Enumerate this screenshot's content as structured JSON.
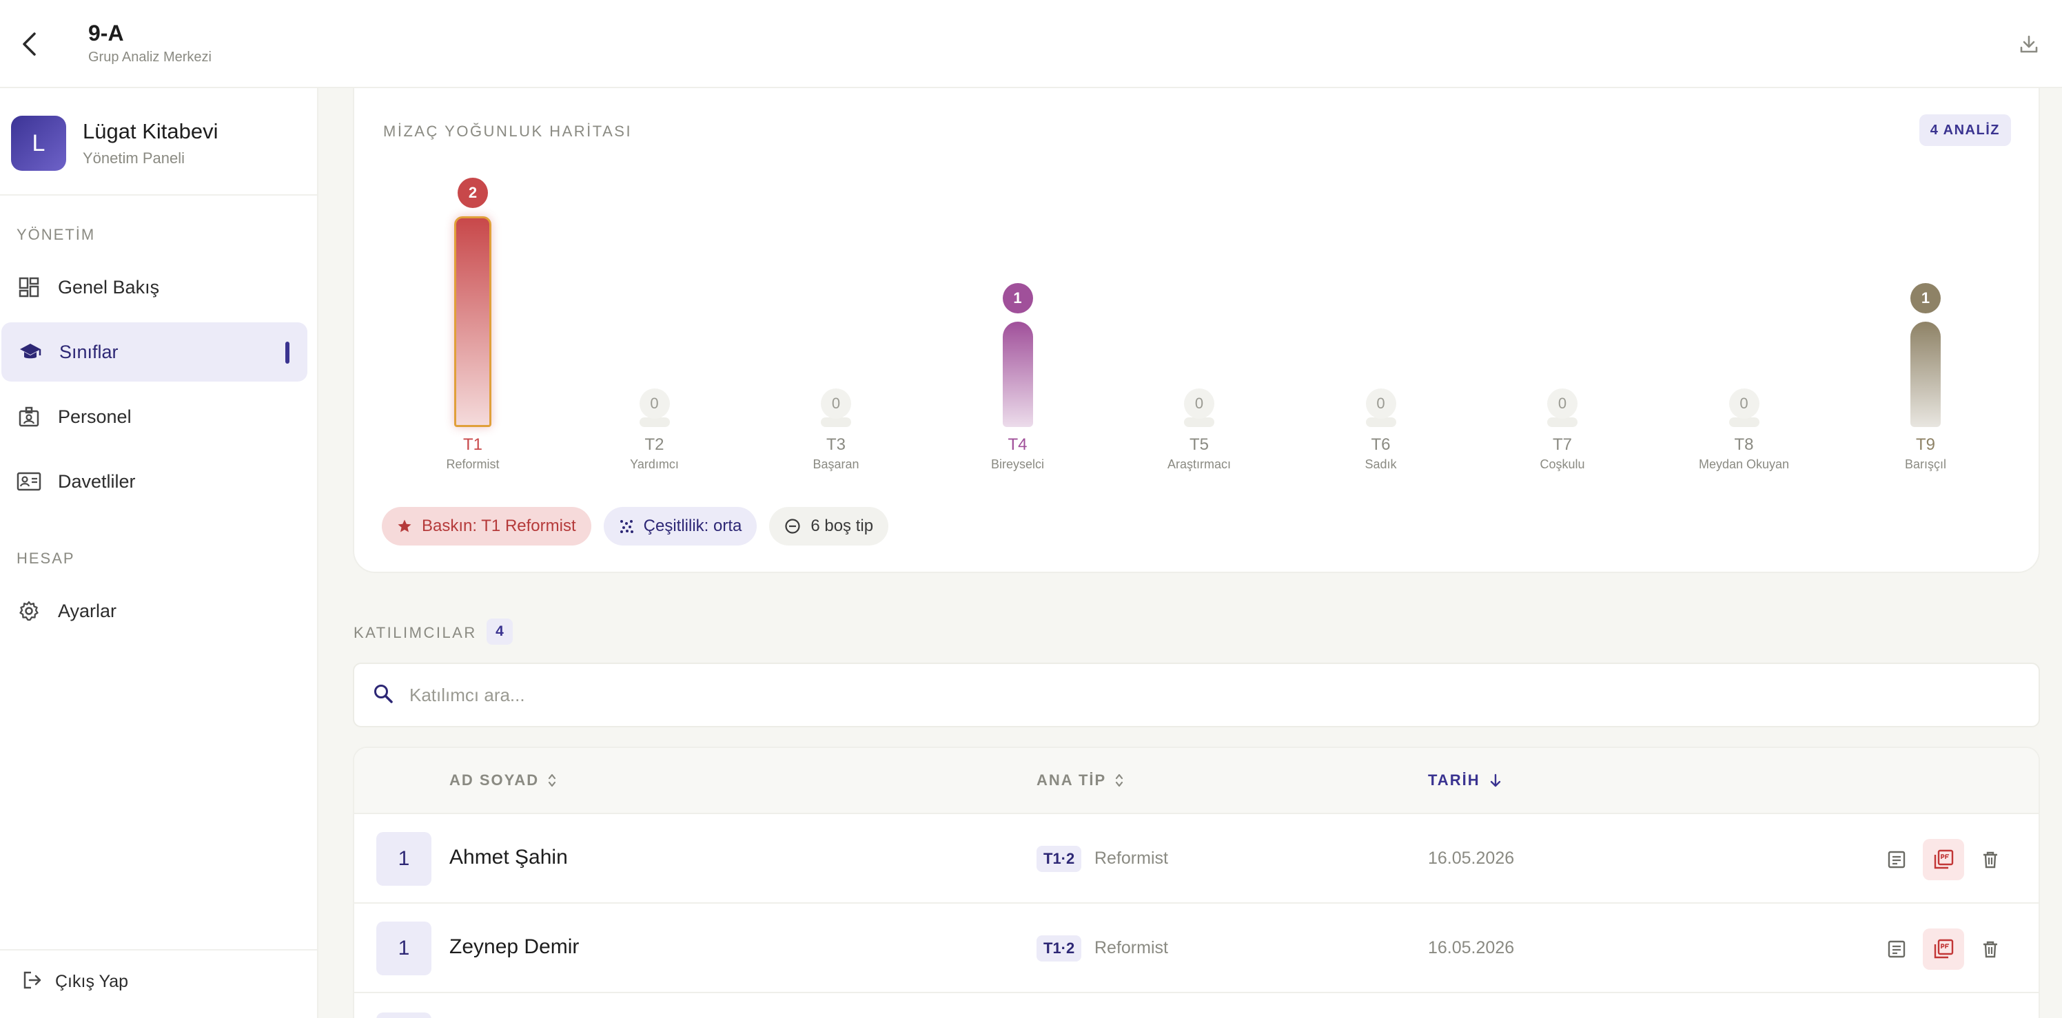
{
  "header": {
    "title": "9-A",
    "subtitle": "Grup Analiz Merkezi"
  },
  "sidebar": {
    "brand_initial": "L",
    "brand_name": "Lügat Kitabevi",
    "brand_sub": "Yönetim Paneli",
    "section_management": "YÖNETİM",
    "section_account": "HESAP",
    "items": [
      {
        "label": "Genel Bakış",
        "icon": "dashboard-icon"
      },
      {
        "label": "Sınıflar",
        "icon": "graduation-cap-icon",
        "active": true
      },
      {
        "label": "Personel",
        "icon": "staff-badge-icon"
      },
      {
        "label": "Davetliler",
        "icon": "contact-card-icon"
      }
    ],
    "settings_label": "Ayarlar",
    "logout_label": "Çıkış Yap"
  },
  "heatmap": {
    "title": "MİZAÇ YOĞUNLUK HARİTASI",
    "badge": "4 ANALİZ"
  },
  "chart_data": {
    "type": "bar",
    "title": "MİZAÇ YOĞUNLUK HARİTASI",
    "categories": [
      "T1",
      "T2",
      "T3",
      "T4",
      "T5",
      "T6",
      "T7",
      "T8",
      "T9"
    ],
    "category_names": [
      "Reformist",
      "Yardımcı",
      "Başaran",
      "Bireyselci",
      "Araştırmacı",
      "Sadık",
      "Coşkulu",
      "Meydan Okuyan",
      "Barışçıl"
    ],
    "values": [
      2,
      0,
      0,
      1,
      0,
      0,
      0,
      0,
      1
    ],
    "ylim": [
      0,
      2
    ],
    "grid": false,
    "colors": [
      "#c8484a",
      "#c0c0b8",
      "#c0c0b8",
      "#a0509a",
      "#c0c0b8",
      "#c0c0b8",
      "#c0c0b8",
      "#c0c0b8",
      "#8e8266"
    ],
    "highlighted": "T1"
  },
  "chips": {
    "dominant": "Baskın: T1 Reformist",
    "diversity": "Çeşitlilik: orta",
    "empty": "6 boş tip"
  },
  "participants": {
    "label": "KATILIMCILAR",
    "count": "4",
    "search_placeholder": "Katılımcı ara...",
    "columns": {
      "name": "AD SOYAD",
      "type": "ANA TİP",
      "date": "TARİH"
    },
    "rows": [
      {
        "num": "1",
        "name": "Ahmet Şahin",
        "type_code": "T1·2",
        "type_name": "Reformist",
        "date": "16.05.2026"
      },
      {
        "num": "1",
        "name": "Zeynep Demir",
        "type_code": "T1·2",
        "type_name": "Reformist",
        "date": "16.05.2026"
      }
    ]
  }
}
